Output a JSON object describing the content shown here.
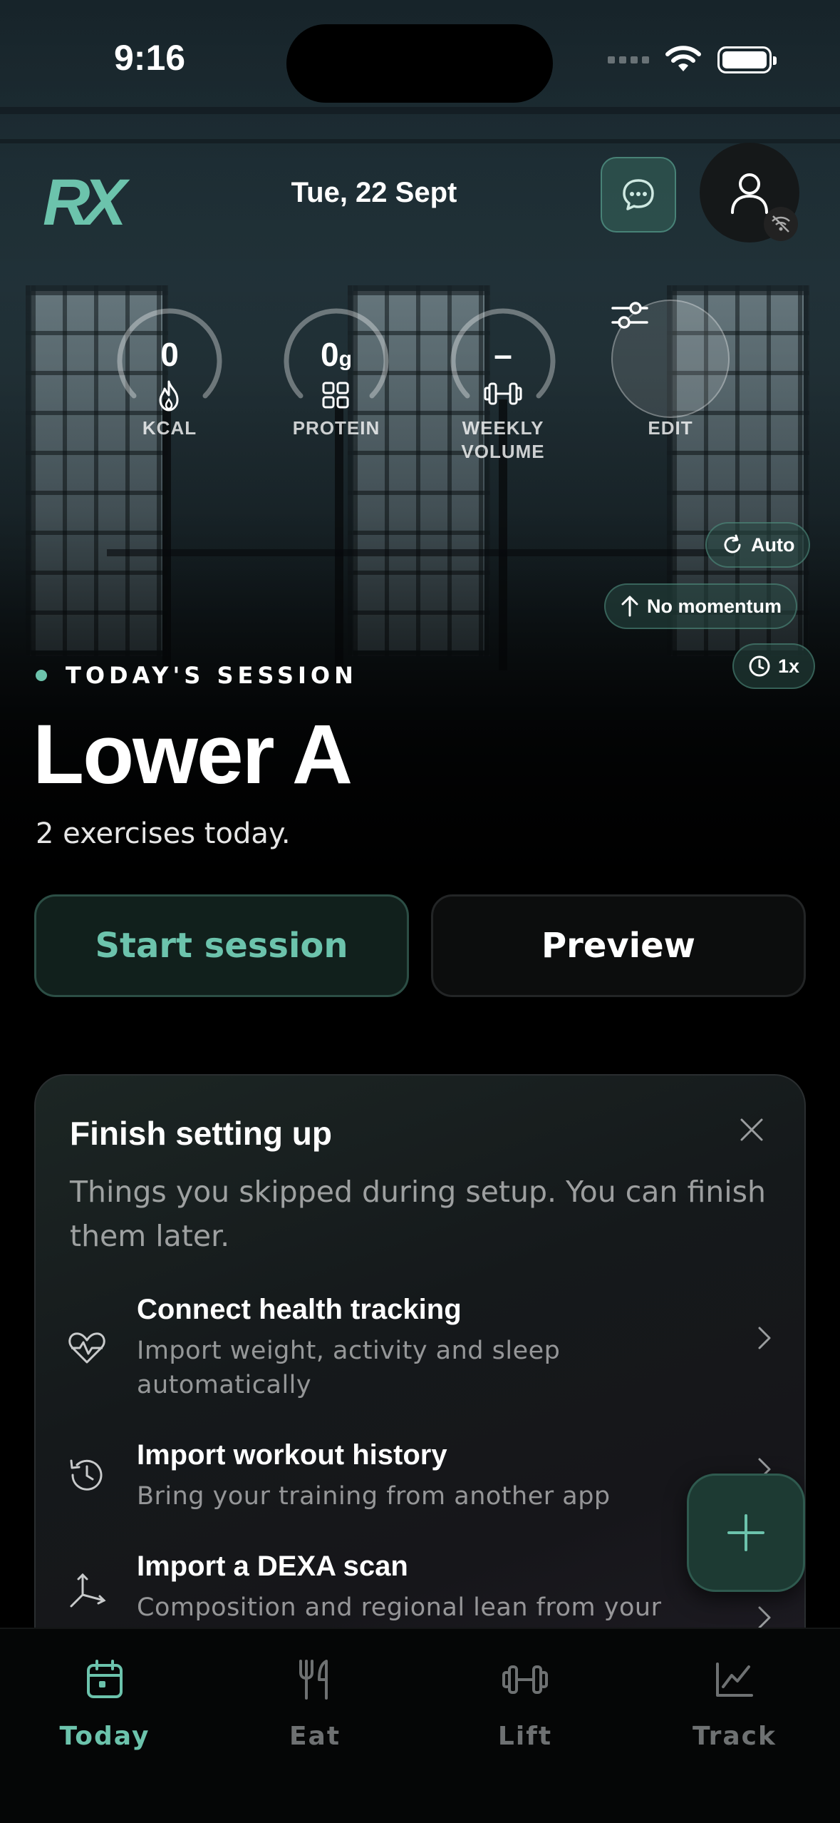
{
  "status_bar": {
    "time": "9:16"
  },
  "header": {
    "logo": "RX",
    "date": "Tue, 22 Sept"
  },
  "stats": [
    {
      "value": "0",
      "unit": "",
      "label": "KCAL",
      "icon": "flame-icon"
    },
    {
      "value": "0",
      "unit": "g",
      "label": "PROTEIN",
      "icon": "grid-icon"
    },
    {
      "value": "–",
      "unit": "",
      "label": "WEEKLY VOLUME",
      "icon": "dumbbell-icon"
    },
    {
      "value": "",
      "unit": "",
      "label": "EDIT",
      "icon": "sliders-icon"
    }
  ],
  "chips": {
    "auto": "Auto",
    "momentum": "No momentum",
    "speed": "1x"
  },
  "session": {
    "tag": "TODAY'S SESSION",
    "title": "Lower A",
    "subtitle": "2 exercises today.",
    "start_label": "Start session",
    "preview_label": "Preview"
  },
  "setup_card": {
    "title": "Finish setting up",
    "description": "Things you skipped during setup. You can finish them later.",
    "items": [
      {
        "title": "Connect health tracking",
        "description": "Import weight, activity and sleep automatically",
        "icon": "heart-pulse-icon"
      },
      {
        "title": "Import workout history",
        "description": "Bring your training from another app",
        "icon": "history-icon"
      },
      {
        "title": "Import a DEXA scan",
        "description": "Composition and regional lean from your",
        "icon": "axes-icon"
      }
    ]
  },
  "tabs": [
    {
      "label": "Today",
      "icon": "calendar-icon",
      "active": true
    },
    {
      "label": "Eat",
      "icon": "utensils-icon",
      "active": false
    },
    {
      "label": "Lift",
      "icon": "dumbbell-icon",
      "active": false
    },
    {
      "label": "Track",
      "icon": "chart-line-icon",
      "active": false
    }
  ],
  "colors": {
    "accent": "#6cc3ac",
    "background": "#000000",
    "card": "#16191b"
  }
}
